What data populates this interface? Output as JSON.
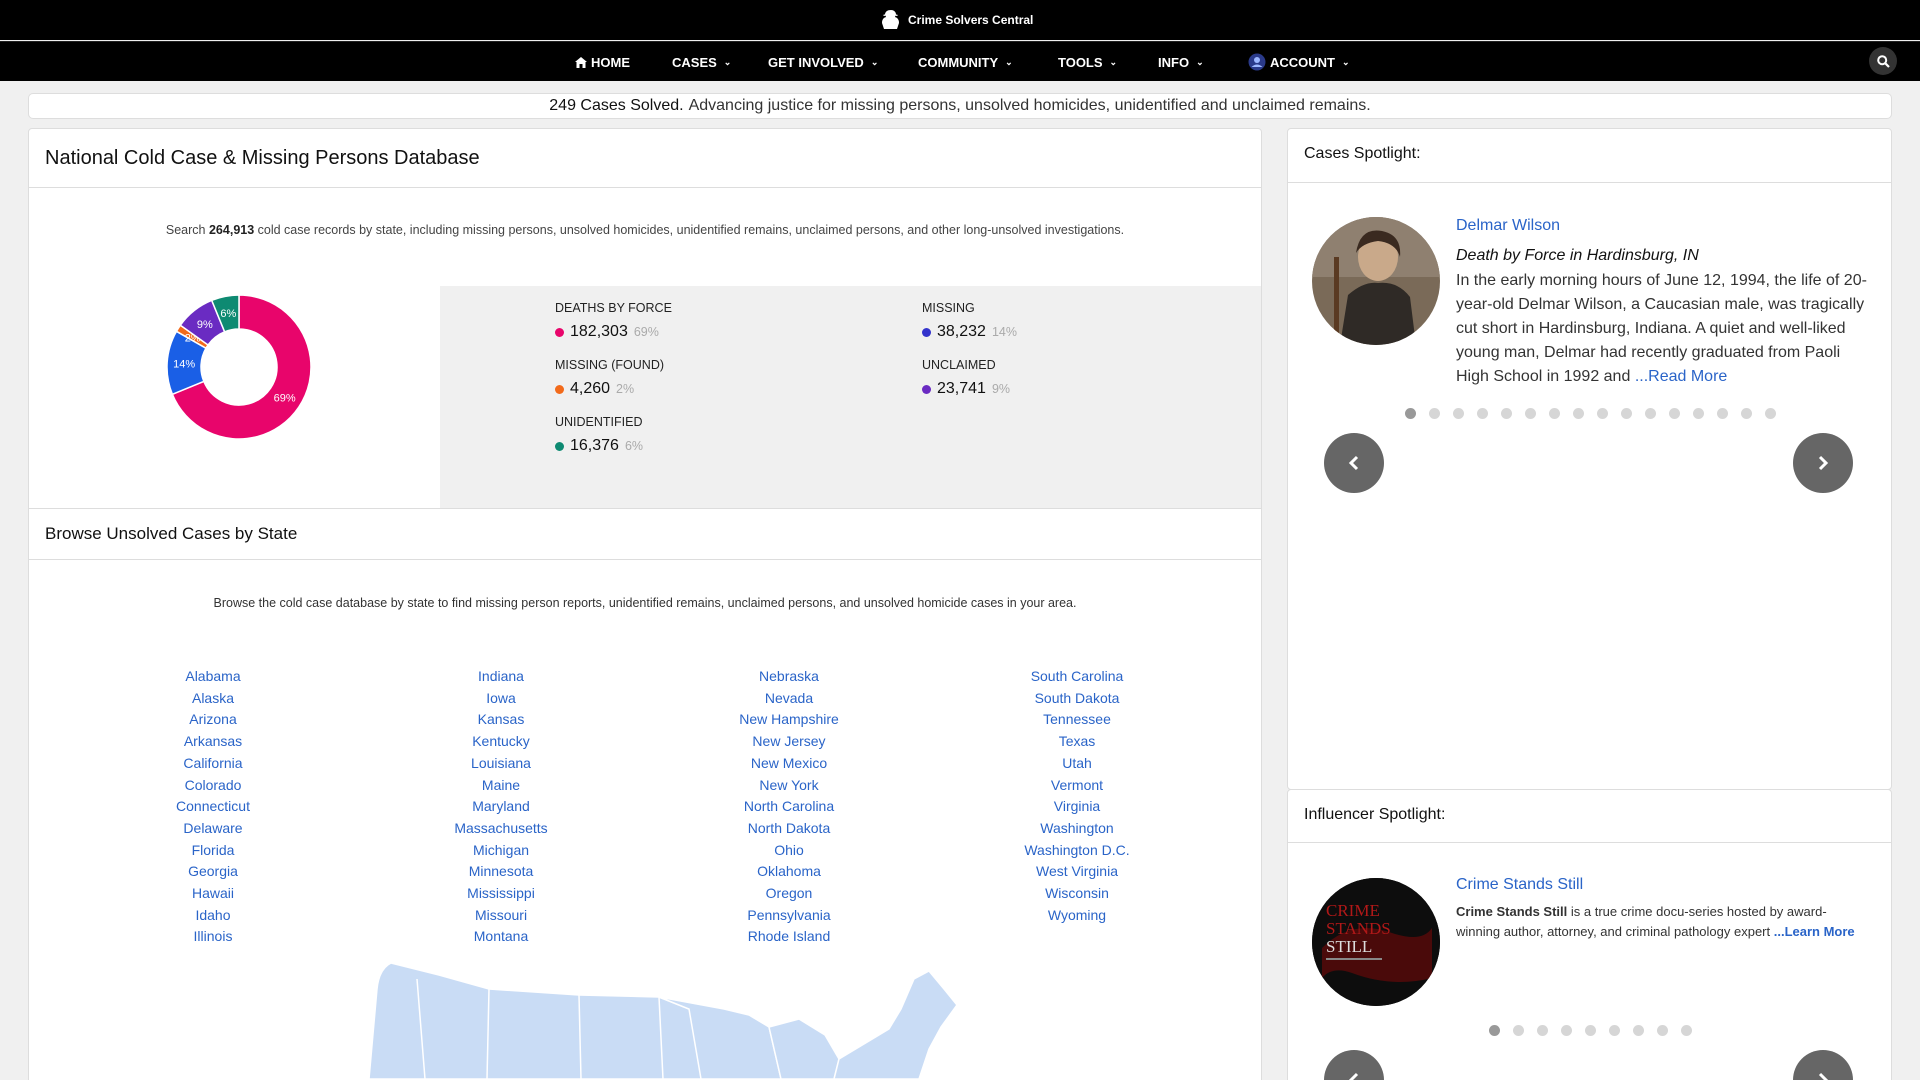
{
  "brand": {
    "name": "Crime Solvers Central"
  },
  "nav": {
    "items": [
      {
        "label": "HOME",
        "icon": "home-icon"
      },
      {
        "label": "CASES"
      },
      {
        "label": "GET INVOLVED"
      },
      {
        "label": "COMMUNITY"
      },
      {
        "label": "TOOLS"
      },
      {
        "label": "INFO"
      },
      {
        "label": "ACCOUNT",
        "icon": "user-icon"
      }
    ],
    "search_icon": "search-icon"
  },
  "banner": {
    "count_text": "249 Cases Solved.",
    "text": "Advancing justice for missing persons, unsolved homicides, unidentified and unclaimed remains."
  },
  "database": {
    "title": "National Cold Case & Missing Persons Database",
    "search_prefix": "Search",
    "record_count": "264,913",
    "search_suffix": "cold case records by state, including missing persons, unsolved homicides, unidentified remains, unclaimed persons, and other long-unsolved investigations."
  },
  "chart_data": {
    "type": "pie",
    "categories": [
      "Deaths by Force",
      "Missing",
      "Missing (Found)",
      "Unclaimed",
      "Unidentified"
    ],
    "values": [
      182303,
      38232,
      4260,
      23741,
      16376
    ],
    "percent_labels": [
      "69%",
      "14%",
      "2%",
      "9%",
      "6%"
    ],
    "colors": [
      "#e8056b",
      "#1a5fe6",
      "#f26a1b",
      "#6a2bc2",
      "#0e8a72"
    ]
  },
  "stats": [
    {
      "label": "DEATHS BY FORCE",
      "value": "182,303",
      "pct": "69%",
      "color": "#e8056b"
    },
    {
      "label": "MISSING",
      "value": "38,232",
      "pct": "14%",
      "color": "#3333cc"
    },
    {
      "label": "MISSING (FOUND)",
      "value": "4,260",
      "pct": "2%",
      "color": "#f26a1b"
    },
    {
      "label": "UNCLAIMED",
      "value": "23,741",
      "pct": "9%",
      "color": "#6a2bc2"
    },
    {
      "label": "UNIDENTIFIED",
      "value": "16,376",
      "pct": "6%",
      "color": "#0e8a72"
    }
  ],
  "browse": {
    "title": "Browse Unsolved Cases by State",
    "desc": "Browse the cold case database by state to find missing person reports, unidentified remains, unclaimed persons, and unsolved homicide cases in your area.",
    "columns": [
      [
        "Alabama",
        "Alaska",
        "Arizona",
        "Arkansas",
        "California",
        "Colorado",
        "Connecticut",
        "Delaware",
        "Florida",
        "Georgia",
        "Hawaii",
        "Idaho",
        "Illinois"
      ],
      [
        "Indiana",
        "Iowa",
        "Kansas",
        "Kentucky",
        "Louisiana",
        "Maine",
        "Maryland",
        "Massachusetts",
        "Michigan",
        "Minnesota",
        "Mississippi",
        "Missouri",
        "Montana"
      ],
      [
        "Nebraska",
        "Nevada",
        "New Hampshire",
        "New Jersey",
        "New Mexico",
        "New York",
        "North Carolina",
        "North Dakota",
        "Ohio",
        "Oklahoma",
        "Oregon",
        "Pennsylvania",
        "Rhode Island"
      ],
      [
        "South Carolina",
        "South Dakota",
        "Tennessee",
        "Texas",
        "Utah",
        "Vermont",
        "Virginia",
        "Washington",
        "Washington D.C.",
        "West Virginia",
        "Wisconsin",
        "Wyoming"
      ]
    ]
  },
  "cases_spotlight": {
    "title": "Cases Spotlight:",
    "name": "Delmar Wilson",
    "subtitle": "Death by Force in Hardinsburg, IN",
    "body": "In the early morning hours of June 12, 1994, the life of 20-year-old Delmar Wilson, a Caucasian male, was tragically cut short in Hardinsburg, Indiana. A quiet and well-liked young man, Delmar had recently graduated from Paoli High School in 1992 and",
    "read_more": "...Read More",
    "dots": 16,
    "active_dot": 0
  },
  "influencer_spotlight": {
    "title": "Influencer Spotlight:",
    "name": "Crime Stands Still",
    "body_bold": "Crime Stands Still",
    "body": "is a true crime docu-series hosted by award-winning author, attorney, and criminal pathology expert",
    "learn_more": "...Learn More",
    "dots": 9,
    "active_dot": 0,
    "logo_lines": [
      "CRIME",
      "STANDS",
      "STILL"
    ]
  }
}
